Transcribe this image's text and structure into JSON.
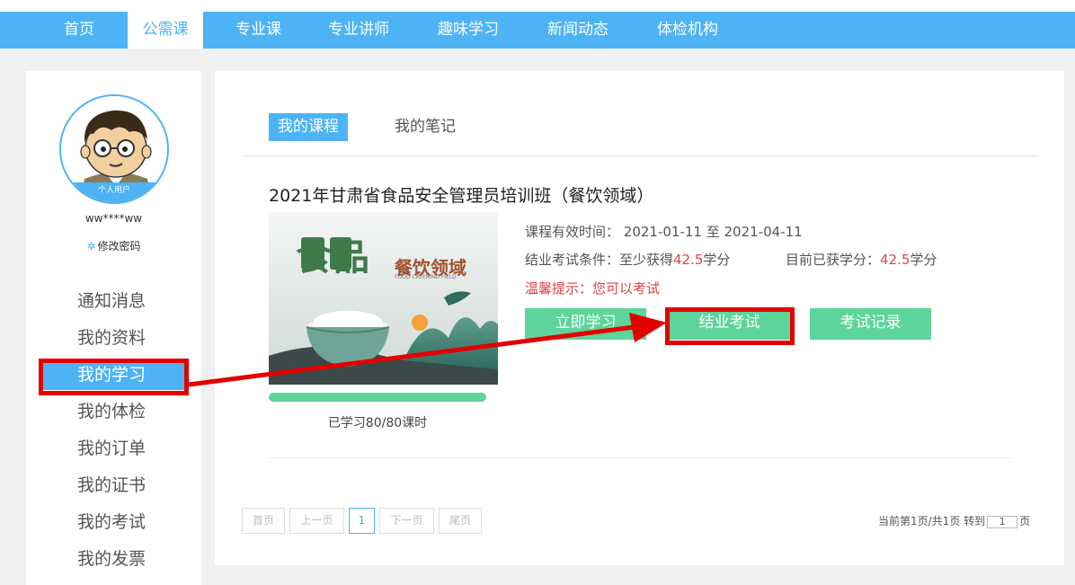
{
  "nav": {
    "items": [
      "首页",
      "公需课",
      "专业课",
      "专业讲师",
      "趣味学习",
      "新闻动态",
      "体检机构"
    ],
    "active_index": 1
  },
  "profile": {
    "avatar_badge": "个人用户",
    "username": "ww****ww",
    "change_password": "修改密码",
    "gear_icon": "gear-icon"
  },
  "sidebar": {
    "items": [
      "通知消息",
      "我的资料",
      "我的学习",
      "我的体检",
      "我的订单",
      "我的证书",
      "我的考试",
      "我的发票"
    ],
    "active_index": 2
  },
  "tabs": {
    "my_courses": "我的课程",
    "my_notes": "我的笔记"
  },
  "course": {
    "title": "2021年甘肃省食品安全管理员培训班（餐饮领域）",
    "thumbnail": {
      "big": "食品",
      "small": "餐饮领域",
      "sub": "FOOD CATERING FIELD"
    },
    "validity_label": "课程有效时间：",
    "validity_value": "2021-01-11 至 2021-04-11",
    "exam_condition_label": "结业考试条件：至少获得",
    "exam_condition_value": "42.5",
    "credit_unit": "学分",
    "earned_label": "目前已获学分：",
    "earned_value": "42.5",
    "tip": "温馨提示：您可以考试",
    "progress_fraction": 1.0,
    "progress_text": "已学习80/80课时",
    "buttons": {
      "study": "立即学习",
      "exam": "结业考试",
      "records": "考试记录"
    }
  },
  "pagination": {
    "first": "首页",
    "prev": "上一页",
    "current": "1",
    "next": "下一页",
    "last": "尾页",
    "info_prefix": "当前第1页/共1页 转到",
    "jump_value": "1",
    "info_suffix": "页"
  },
  "colors": {
    "primary": "#4db3f5",
    "button_green": "#5dd49a",
    "annotation_red": "#e30000",
    "highlight_red": "#e04343"
  }
}
